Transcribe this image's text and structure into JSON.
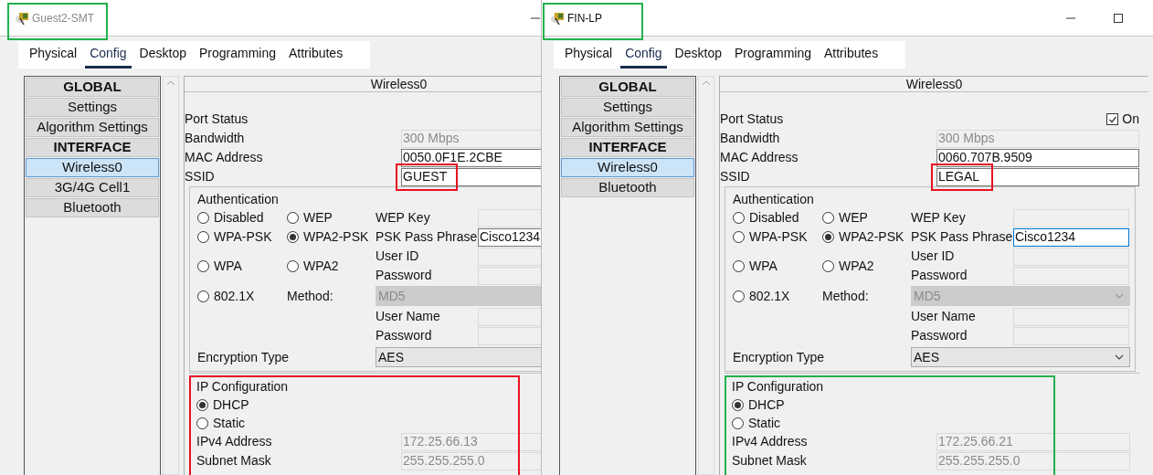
{
  "windows": [
    {
      "title": "Guest2-SMT",
      "active": false,
      "markups": [
        {
          "kind": "title",
          "color": "#22b14c"
        },
        {
          "kind": "ssid",
          "color": "#e81123"
        },
        {
          "kind": "ip",
          "color": "#e81123"
        }
      ],
      "tabs": [
        {
          "label": "Physical",
          "selected": false
        },
        {
          "label": "Config",
          "selected": true
        },
        {
          "label": "Desktop",
          "selected": false
        },
        {
          "label": "Programming",
          "selected": false
        },
        {
          "label": "Attributes",
          "selected": false
        }
      ],
      "sidebar": [
        {
          "label": "GLOBAL",
          "kind": "header"
        },
        {
          "label": "Settings",
          "kind": "item",
          "selected": false
        },
        {
          "label": "Algorithm Settings",
          "kind": "item",
          "selected": false
        },
        {
          "label": "INTERFACE",
          "kind": "header"
        },
        {
          "label": "Wireless0",
          "kind": "item",
          "selected": true
        },
        {
          "label": "3G/4G Cell1",
          "kind": "item",
          "selected": false
        },
        {
          "label": "Bluetooth",
          "kind": "item",
          "selected": false
        }
      ],
      "panel": {
        "title": "Wireless0",
        "port_status": {
          "label": "Port Status"
        },
        "fields": [
          {
            "label": "Bandwidth",
            "value": "300 Mbps",
            "disabled": true
          },
          {
            "label": "MAC Address",
            "value": "0050.0F1E.2CBE",
            "disabled": false
          },
          {
            "label": "SSID",
            "value": "GUEST",
            "disabled": false
          }
        ],
        "auth": {
          "title": "Authentication",
          "rows": [
            {
              "kind": "options",
              "options": [
                {
                  "label": "Disabled",
                  "selected": false
                },
                {
                  "label": "WEP",
                  "selected": false
                }
              ],
              "fields": [
                {
                  "label": "WEP Key",
                  "disabled": true
                }
              ]
            },
            {
              "kind": "options",
              "options": [
                {
                  "label": "WPA-PSK",
                  "selected": false
                },
                {
                  "label": "WPA2-PSK",
                  "selected": true
                }
              ],
              "fields": [
                {
                  "label": "PSK Pass Phrase",
                  "value": "Cisco1234",
                  "disabled": false,
                  "focused": false
                }
              ]
            },
            {
              "kind": "options",
              "options": [
                {
                  "label": "WPA",
                  "selected": false
                },
                {
                  "label": "WPA2",
                  "selected": false
                }
              ],
              "fields": [
                {
                  "label": "User ID",
                  "disabled": true
                },
                {
                  "label": "Password",
                  "disabled": true
                }
              ]
            },
            {
              "kind": "method",
              "options": [
                {
                  "label": "802.1X",
                  "selected": false
                }
              ],
              "method": {
                "label": "Method:",
                "value": "MD5",
                "disabled": true
              }
            },
            {
              "kind": "options",
              "options": [],
              "fields": [
                {
                  "label": "User Name",
                  "disabled": true
                },
                {
                  "label": "Password",
                  "disabled": true
                }
              ]
            }
          ],
          "encryption": {
            "label": "Encryption Type",
            "value": "AES",
            "disabled": false
          }
        },
        "ip": {
          "title": "IP Configuration",
          "modes": [
            {
              "label": "DHCP",
              "selected": true
            },
            {
              "label": "Static",
              "selected": false
            }
          ],
          "fields": [
            {
              "label": "IPv4 Address",
              "value": "172.25.66.13",
              "disabled": true
            },
            {
              "label": "Subnet Mask",
              "value": "255.255.255.0",
              "disabled": true
            }
          ]
        }
      }
    },
    {
      "title": "FIN-LP",
      "active": true,
      "markups": [
        {
          "kind": "title",
          "color": "#22b14c"
        },
        {
          "kind": "ssid",
          "color": "#e81123"
        },
        {
          "kind": "ip",
          "color": "#22b14c"
        }
      ],
      "tabs": [
        {
          "label": "Physical",
          "selected": false
        },
        {
          "label": "Config",
          "selected": true
        },
        {
          "label": "Desktop",
          "selected": false
        },
        {
          "label": "Programming",
          "selected": false
        },
        {
          "label": "Attributes",
          "selected": false
        }
      ],
      "sidebar": [
        {
          "label": "GLOBAL",
          "kind": "header"
        },
        {
          "label": "Settings",
          "kind": "item",
          "selected": false
        },
        {
          "label": "Algorithm Settings",
          "kind": "item",
          "selected": false
        },
        {
          "label": "INTERFACE",
          "kind": "header"
        },
        {
          "label": "Wireless0",
          "kind": "item",
          "selected": true
        },
        {
          "label": "Bluetooth",
          "kind": "item",
          "selected": false
        }
      ],
      "panel": {
        "title": "Wireless0",
        "port_status": {
          "label": "Port Status",
          "checkbox": {
            "label": "On",
            "checked": true
          }
        },
        "fields": [
          {
            "label": "Bandwidth",
            "value": "300 Mbps",
            "disabled": true
          },
          {
            "label": "MAC Address",
            "value": "0060.707B.9509",
            "disabled": false
          },
          {
            "label": "SSID",
            "value": "LEGAL",
            "disabled": false
          }
        ],
        "auth": {
          "title": "Authentication",
          "rows": [
            {
              "kind": "options",
              "options": [
                {
                  "label": "Disabled",
                  "selected": false
                },
                {
                  "label": "WEP",
                  "selected": false
                }
              ],
              "fields": [
                {
                  "label": "WEP Key",
                  "disabled": true
                }
              ]
            },
            {
              "kind": "options",
              "options": [
                {
                  "label": "WPA-PSK",
                  "selected": false
                },
                {
                  "label": "WPA2-PSK",
                  "selected": true
                }
              ],
              "fields": [
                {
                  "label": "PSK Pass Phrase",
                  "value": "Cisco1234",
                  "disabled": false,
                  "focused": true
                }
              ]
            },
            {
              "kind": "options",
              "options": [
                {
                  "label": "WPA",
                  "selected": false
                },
                {
                  "label": "WPA2",
                  "selected": false
                }
              ],
              "fields": [
                {
                  "label": "User ID",
                  "disabled": true
                },
                {
                  "label": "Password",
                  "disabled": true
                }
              ]
            },
            {
              "kind": "method",
              "options": [
                {
                  "label": "802.1X",
                  "selected": false
                }
              ],
              "method": {
                "label": "Method:",
                "value": "MD5",
                "disabled": true
              }
            },
            {
              "kind": "options",
              "options": [],
              "fields": [
                {
                  "label": "User Name",
                  "disabled": true
                },
                {
                  "label": "Password",
                  "disabled": true
                }
              ]
            }
          ],
          "encryption": {
            "label": "Encryption Type",
            "value": "AES",
            "disabled": false
          }
        },
        "ip": {
          "title": "IP Configuration",
          "modes": [
            {
              "label": "DHCP",
              "selected": true
            },
            {
              "label": "Static",
              "selected": false
            }
          ],
          "fields": [
            {
              "label": "IPv4 Address",
              "value": "172.25.66.21",
              "disabled": true
            },
            {
              "label": "Subnet Mask",
              "value": "255.255.255.0",
              "disabled": true
            }
          ]
        }
      }
    }
  ]
}
